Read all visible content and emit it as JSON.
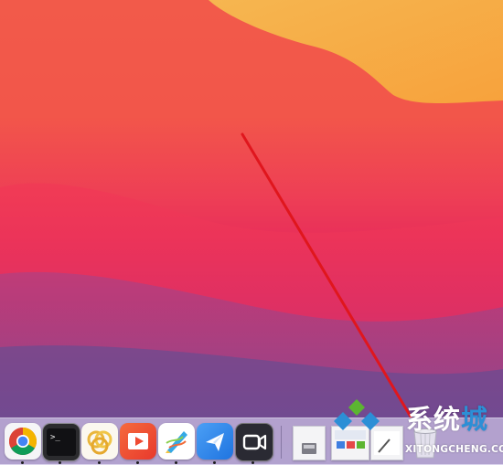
{
  "screen": "macOS desktop with Dock",
  "annotation": {
    "color": "#e0161d"
  },
  "dock": {
    "apps": [
      {
        "name": "chrome-app",
        "icon": "chrome-icon",
        "running": true
      },
      {
        "name": "terminal-app",
        "icon": "terminal-icon",
        "running": true
      },
      {
        "name": "loop-app",
        "icon": "loop-rings-icon",
        "running": true
      },
      {
        "name": "slides-app",
        "icon": "play-slides-icon",
        "running": true
      },
      {
        "name": "pencil-app",
        "icon": "pencil-icon",
        "running": true
      },
      {
        "name": "feishu-app",
        "icon": "paper-plane-icon",
        "running": true
      },
      {
        "name": "facetime-app",
        "icon": "camera-icon",
        "running": true
      }
    ],
    "right_items": [
      {
        "name": "document-stack",
        "icon": "document-icon"
      },
      {
        "name": "screenshot-thumbnail",
        "icon": "screenshot-icon"
      },
      {
        "name": "screenshot-thumbnail-2",
        "icon": "screenshot-icon"
      },
      {
        "name": "trash",
        "icon": "trash-icon"
      }
    ]
  },
  "watermark": {
    "title_white": "系统",
    "title_blue": "城",
    "subtitle": "XITONGCHENG.COM",
    "colors": {
      "blue": "#2c8fd6",
      "green": "#5cb531"
    }
  }
}
